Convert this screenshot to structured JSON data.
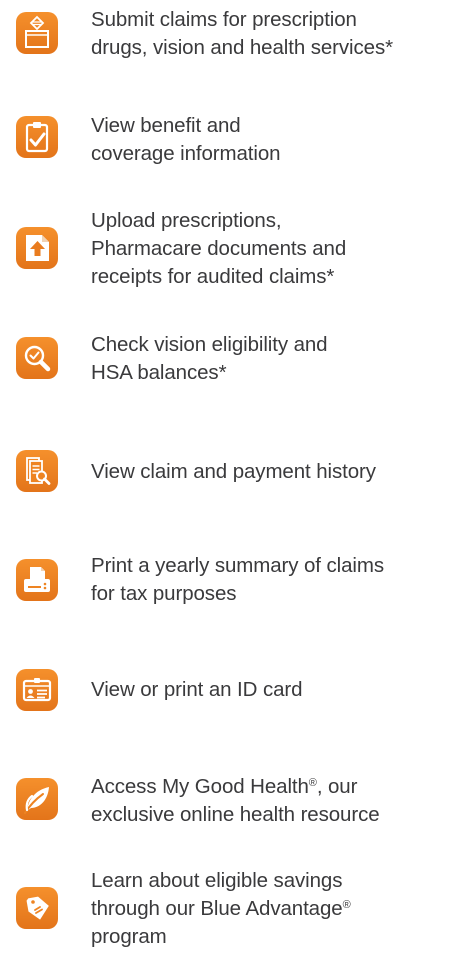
{
  "accent_color": "#ee8422",
  "features": [
    {
      "icon": "envelope-form-icon",
      "lines": [
        "Submit claims for prescription",
        "drugs, vision and health services*"
      ]
    },
    {
      "icon": "clipboard-check-icon",
      "lines": [
        "View benefit and",
        "coverage information"
      ]
    },
    {
      "icon": "upload-document-icon",
      "lines": [
        "Upload prescriptions,",
        "Pharmacare documents and",
        "receipts for audited claims*"
      ]
    },
    {
      "icon": "magnifier-check-icon",
      "lines": [
        "Check vision eligibility and",
        "HSA balances*"
      ]
    },
    {
      "icon": "document-search-icon",
      "lines": [
        "View claim and payment history"
      ]
    },
    {
      "icon": "printer-icon",
      "lines": [
        "Print a yearly summary of claims",
        "for tax purposes"
      ]
    },
    {
      "icon": "id-card-icon",
      "lines": [
        "View or print an ID card"
      ]
    },
    {
      "icon": "leaf-icon",
      "line_parts": [
        {
          "before": "Access My Good Health",
          "sup": "®",
          "after": ", our"
        },
        {
          "before": "exclusive online health resource",
          "sup": "",
          "after": ""
        }
      ]
    },
    {
      "icon": "price-tag-icon",
      "line_parts": [
        {
          "before": "Learn about eligible savings",
          "sup": "",
          "after": ""
        },
        {
          "before": "through our Blue Advantage",
          "sup": "®",
          "after": ""
        },
        {
          "before": "program",
          "sup": "",
          "after": ""
        }
      ]
    }
  ]
}
